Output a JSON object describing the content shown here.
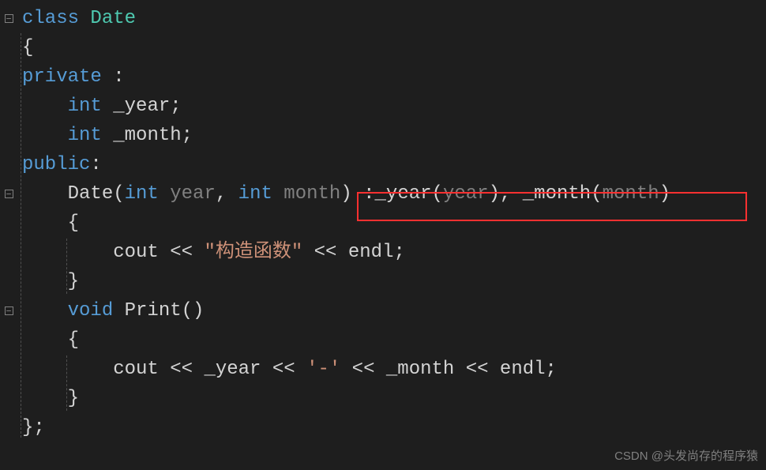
{
  "code": {
    "line1": {
      "kw_class": "class",
      "type_name": "Date"
    },
    "line2": {
      "brace": "{"
    },
    "line3": {
      "kw_private": "private",
      "colon": " :"
    },
    "line4": {
      "kw_int1": "int",
      "field_year": "_year",
      "semi": ";"
    },
    "line5": {
      "kw_int2": "int",
      "field_month": "_month",
      "semi2": ";"
    },
    "line6": {
      "kw_public": "public",
      "colon2": ":"
    },
    "line7": {
      "ctor": "Date",
      "lparen": "(",
      "kw_int_p1": "int",
      "p1": "year",
      "comma": ",",
      "kw_int_p2": "int",
      "p2": "month",
      "rparen": ")",
      "init_colon": ":",
      "init_year_fld": "_year",
      "il": "(",
      "init_year_arg": "year",
      "ir": "),",
      "init_month_fld": "_month",
      "il2": "(",
      "init_month_arg": "month",
      "ir2": ")"
    },
    "line8": {
      "brace2": "{"
    },
    "line9": {
      "cout": "cout",
      "shl1": " << ",
      "str_literal": "\"构造函数\"",
      "shl2": " << ",
      "endl1": "endl",
      "semi3": ";"
    },
    "line10": {
      "brace3": "}"
    },
    "line11": {
      "kw_void": "void",
      "fn_print": "Print",
      "parens": "()"
    },
    "line12": {
      "brace4": "{"
    },
    "line13": {
      "cout2": "cout",
      "shl3": " << ",
      "y": "_year",
      "shl4": " << ",
      "dash": "'-'",
      "shl5": " << ",
      "m": "_month",
      "shl6": " << ",
      "endl2": "endl",
      "semi4": ";"
    },
    "line14": {
      "brace5": "}"
    },
    "line15": {
      "brace6": "};"
    }
  },
  "fold_minus": "−",
  "watermark": "CSDN @头发尚存的程序猿"
}
